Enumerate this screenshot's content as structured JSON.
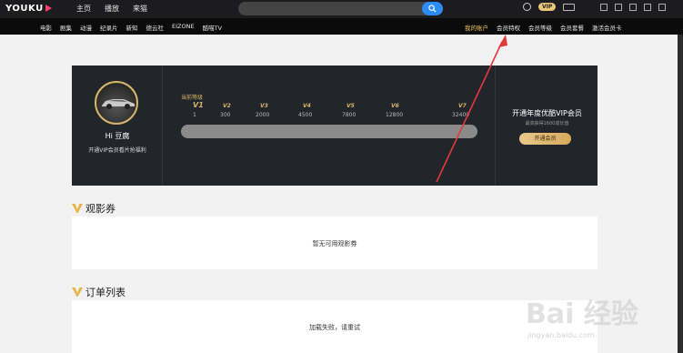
{
  "topbar": {
    "logo": "YOUKU",
    "nav": [
      "主页",
      "播放",
      "来猫"
    ],
    "vip_badge": "VIP"
  },
  "subnav": {
    "left": [
      "电影",
      "剧集",
      "动漫",
      "纪录片",
      "新知",
      "德云社",
      "EIZONE",
      "酷喵TV"
    ],
    "right": [
      "我的账户",
      "会员特权",
      "会员等级",
      "会员套餐",
      "激活会员卡"
    ]
  },
  "profile": {
    "name": "Hi 豆腐",
    "sub": "开通VIP会员看片抢福利"
  },
  "levels": {
    "current_label": "当前等级",
    "items": [
      {
        "name": "V1",
        "value": "1"
      },
      {
        "name": "V2",
        "value": "300"
      },
      {
        "name": "V3",
        "value": "2000"
      },
      {
        "name": "V4",
        "value": "4500"
      },
      {
        "name": "V5",
        "value": "7800"
      },
      {
        "name": "V6",
        "value": "12800"
      },
      {
        "name": "V7",
        "value": "32400"
      }
    ],
    "progress": 0
  },
  "open_year": {
    "title": "开通年度优酷VIP会员",
    "sub": "最高获得1600成长值",
    "button": "开通会员"
  },
  "sections": {
    "coupons_title": "观影券",
    "coupons_empty": "暂无可用观影券",
    "orders_title": "订单列表",
    "orders_error": "加载失败，请重试"
  },
  "watermark": {
    "main": "Bai 经验",
    "sub": "jingyan.baidu.com"
  },
  "colors": {
    "accent_gold": "#d8b66a",
    "search_blue": "#2a8cf4",
    "annotation_red": "#e23a3a"
  }
}
